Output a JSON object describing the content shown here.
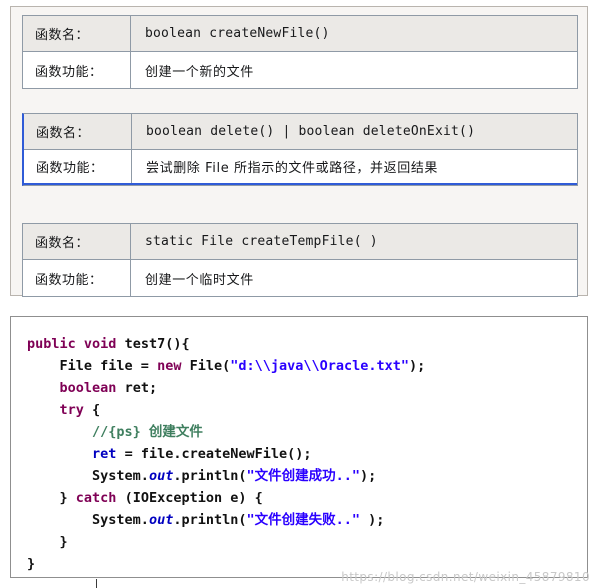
{
  "tables": [
    {
      "rows": [
        {
          "label": "函数名：",
          "value": "boolean createNewFile()",
          "style": "mono"
        },
        {
          "label": "函数功能：",
          "value": "创建一个新的文件",
          "style": "cjk"
        }
      ]
    },
    {
      "rows": [
        {
          "label": "函数名：",
          "value": "boolean delete() | boolean deleteOnExit()",
          "style": "mono"
        },
        {
          "label": "函数功能：",
          "value": "尝试删除 File 所指示的文件或路径，并返回结果",
          "style": "cjk"
        }
      ]
    },
    {
      "rows": [
        {
          "label": "函数名：",
          "value": "static File createTempFile( )",
          "style": "mono"
        },
        {
          "label": "函数功能：",
          "value": "创建一个临时文件",
          "style": "cjk"
        }
      ]
    }
  ],
  "code": {
    "language": "java",
    "lines": [
      "public void test7(){",
      "    File file = new File(\"d:\\\\java\\\\Oracle.txt\");",
      "    boolean ret;",
      "    try {",
      "        //{ps} 创建文件",
      "        ret = file.createNewFile();",
      "        System.out.println(\"文件创建成功..\");",
      "    } catch (IOException e) {",
      "        System.out.println(\"文件创建失败..\" );",
      "    }",
      "}"
    ]
  },
  "watermark": "https://blog.csdn.net/weixin_45879810",
  "colors": {
    "keyword": "#7f0055",
    "string": "#2a00ff",
    "comment": "#3f7f5f",
    "field": "#0000c0",
    "panel_bg": "#f7f5f3",
    "header_row_bg": "#ebe9e6",
    "table_border": "#8f9aa6",
    "selection": "#2f5bd7"
  }
}
